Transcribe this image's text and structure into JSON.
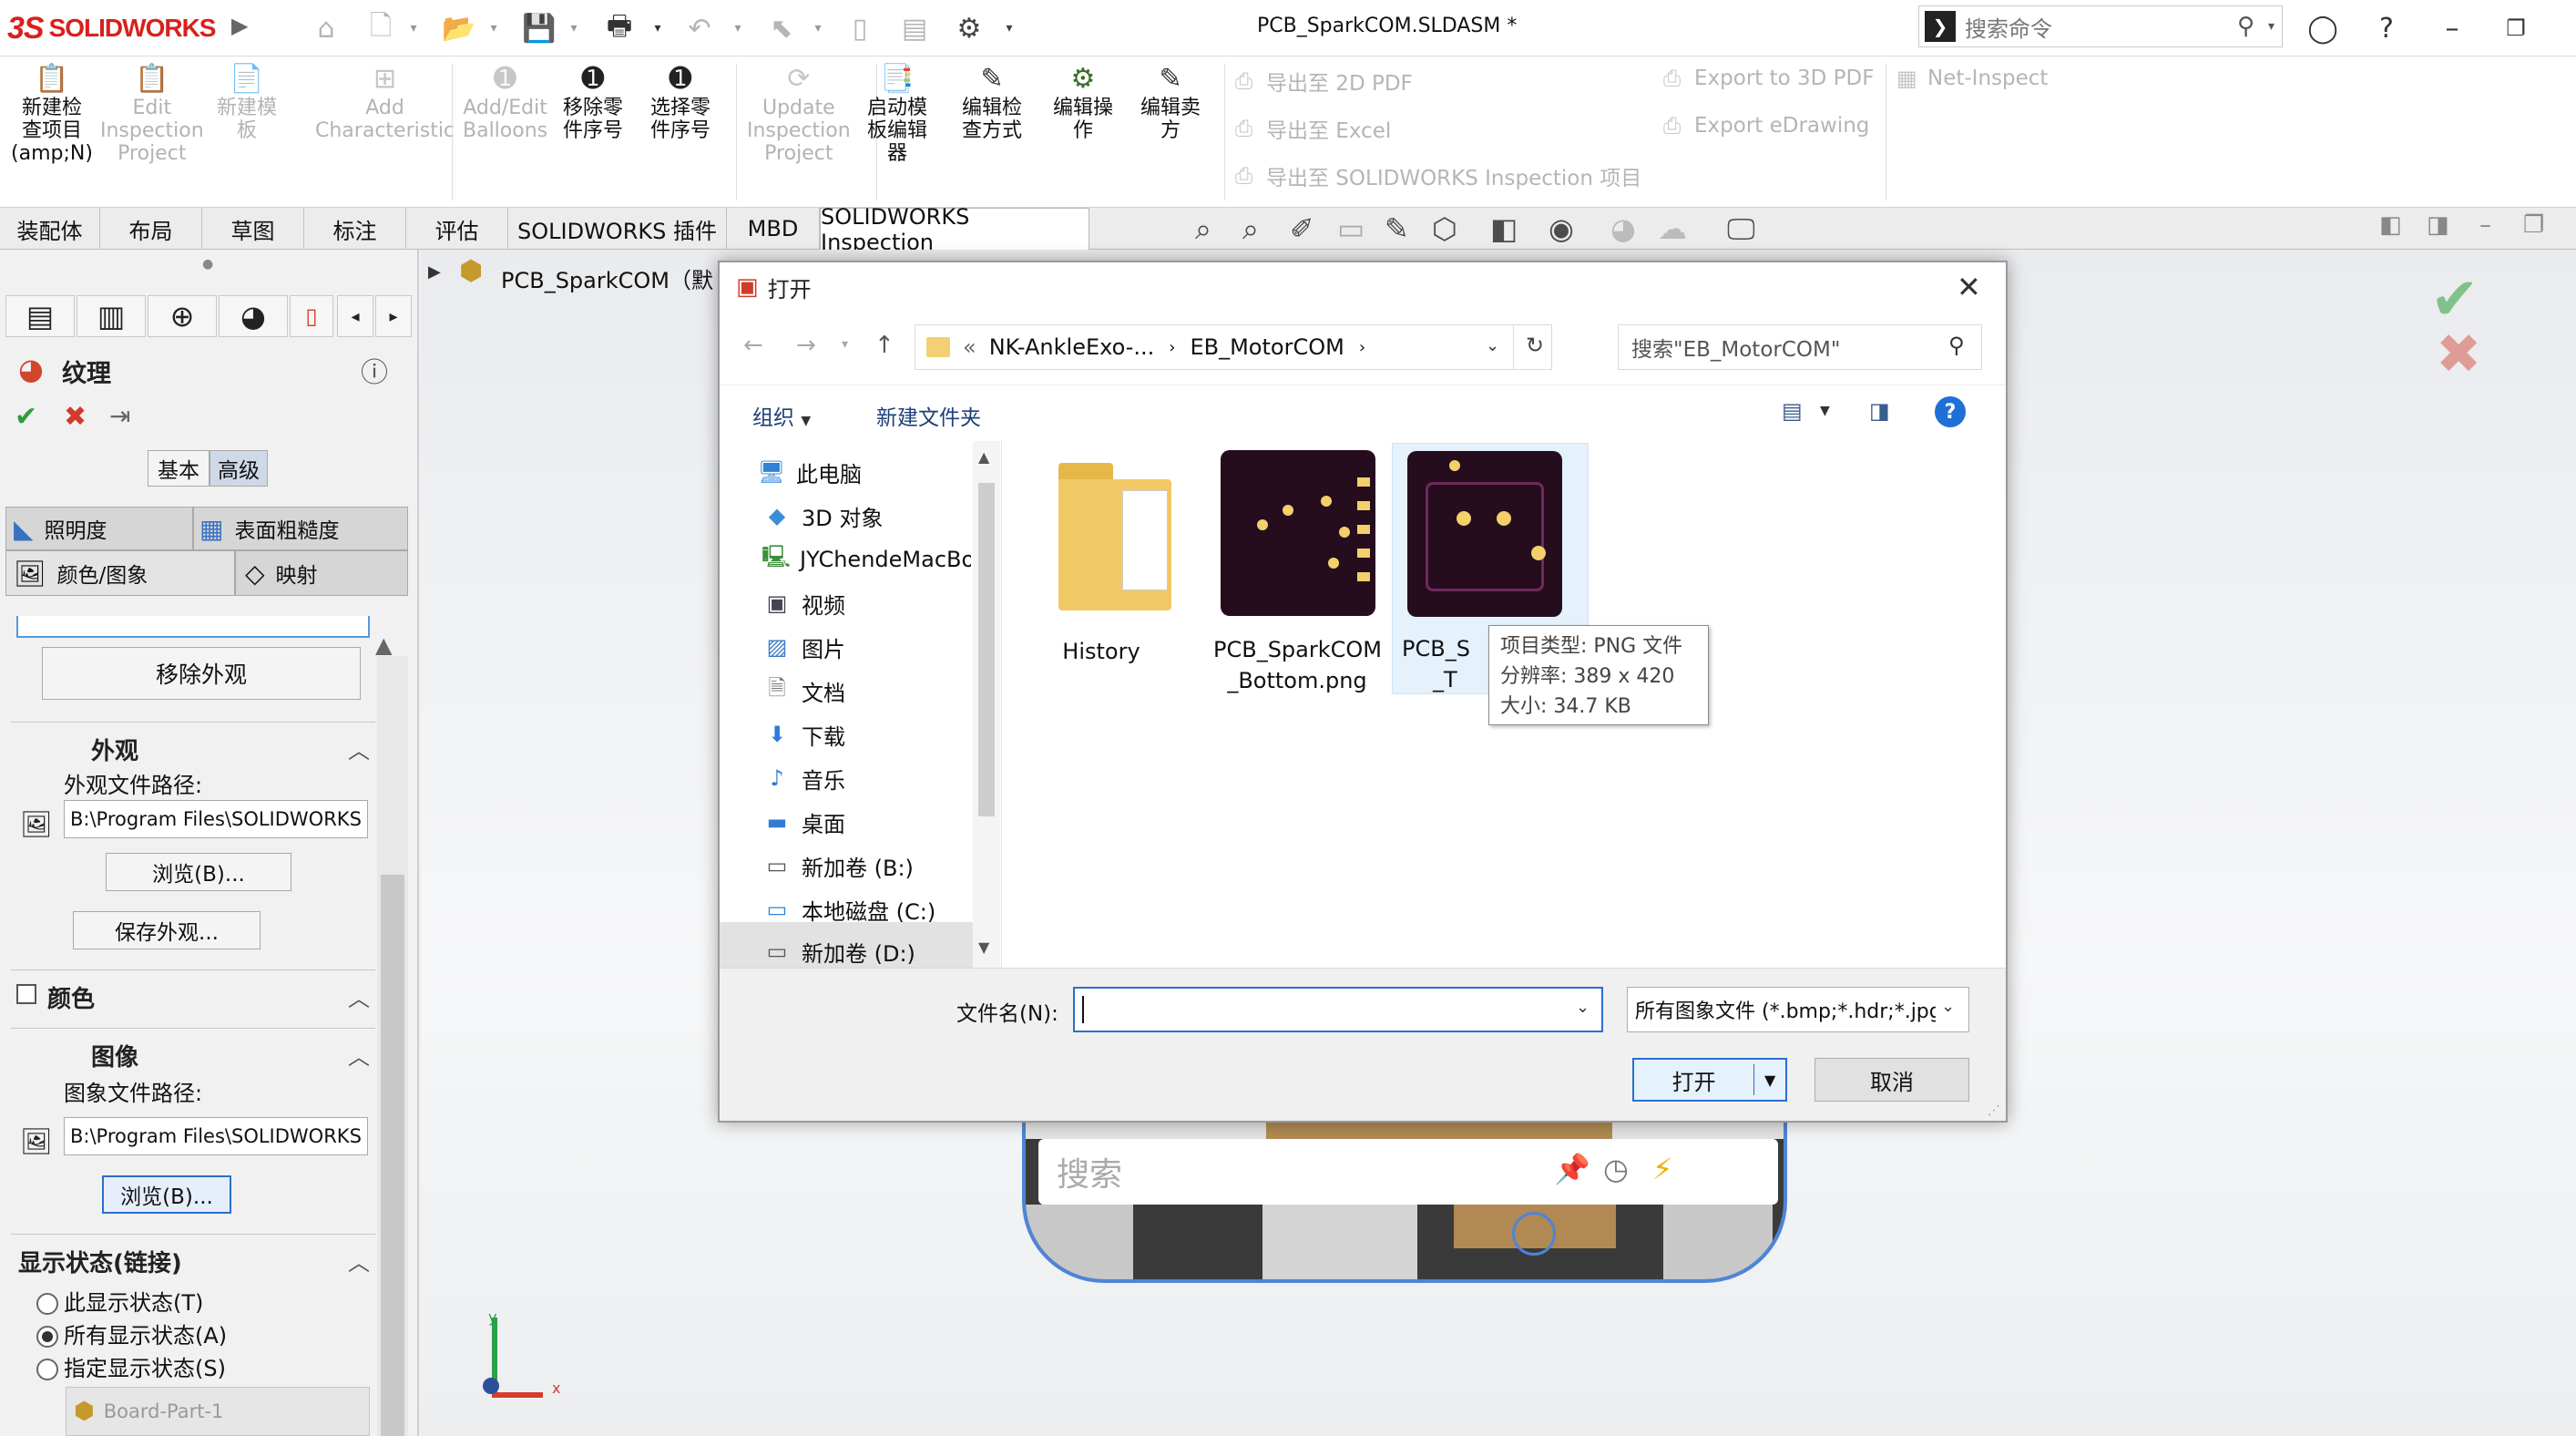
{
  "app": {
    "brand": "SOLIDWORKS",
    "brand_mark": "3S",
    "doc_title": "PCB_SparkCOM.SLDASM *"
  },
  "command_search": {
    "placeholder": "搜索命令"
  },
  "colors": {
    "brand_red": "#d9201c",
    "accent_blue": "#1e6fd6",
    "check_green": "#2e9e3a",
    "x_red": "#d03b2b"
  },
  "ribbon": {
    "buttons": [
      {
        "label": "新建检\n查项目\n(amp;N)",
        "icon": "new-inspection-icon",
        "enabled": true
      },
      {
        "label": "Edit\nInspection\nProject",
        "icon": "edit-inspection-icon",
        "enabled": false
      },
      {
        "label": "新建模\n板",
        "icon": "new-template-icon",
        "enabled": false
      },
      {
        "label": "Add\nCharacteristic",
        "icon": "add-characteristic-icon",
        "enabled": false
      },
      {
        "label": "Add/Edit\nBalloons",
        "icon": "balloons-icon",
        "enabled": false
      },
      {
        "label": "移除零\n件序号",
        "icon": "remove-balloon-icon",
        "enabled": true
      },
      {
        "label": "选择零\n件序号",
        "icon": "select-balloon-icon",
        "enabled": true
      },
      {
        "label": "Update\nInspection\nProject",
        "icon": "update-icon",
        "enabled": false
      },
      {
        "label": "启动模\n板编辑\n器",
        "icon": "template-editor-icon",
        "enabled": true
      },
      {
        "label": "编辑检\n查方式",
        "icon": "edit-method-icon",
        "enabled": true
      },
      {
        "label": "编辑操\n作",
        "icon": "edit-operation-icon",
        "enabled": true
      },
      {
        "label": "编辑卖\n方",
        "icon": "edit-vendor-icon",
        "enabled": true
      }
    ],
    "export_col1": [
      "导出至 2D PDF",
      "导出至 Excel",
      "导出至 SOLIDWORKS Inspection 项目"
    ],
    "export_col2": [
      "Export to 3D PDF",
      "Export eDrawing"
    ],
    "net_inspect": "Net-Inspect"
  },
  "tabs": [
    "装配体",
    "布局",
    "草图",
    "标注",
    "评估",
    "SOLIDWORKS 插件",
    "MBD",
    "SOLIDWORKS Inspection"
  ],
  "tree_root": "PCB_SparkCOM（默",
  "texture_panel": {
    "title": "纹理",
    "mode_basic": "基本",
    "mode_advanced": "高级",
    "subtabs": [
      "照明度",
      "表面粗糙度",
      "颜色/图象",
      "映射"
    ],
    "remove_appearance": "移除外观",
    "appearance": {
      "header": "外观",
      "path_label": "外观文件路径:",
      "path_value": "B:\\Program Files\\SOLIDWORKS Corp\\SOLIDWORKS",
      "browse": "浏览(B)...",
      "save": "保存外观..."
    },
    "color": {
      "header": "颜色"
    },
    "image": {
      "header": "图像",
      "path_label": "图象文件路径:",
      "path_value": "B:\\Program Files\\SOLIDWORKS Corp\\SOLIDWORKS",
      "browse": "浏览(B)..."
    },
    "display_state": {
      "header": "显示状态(链接)",
      "options": [
        "此显示状态(T)",
        "所有显示状态(A)",
        "指定显示状态(S)"
      ],
      "selected": 1
    },
    "component": "Board-Part-1"
  },
  "viewport": {
    "search_placeholder": "搜索",
    "axis_x": "x",
    "axis_y": "y"
  },
  "dialog": {
    "title": "打开",
    "path": [
      "«",
      "NK-AnkleExo-...",
      "EB_MotorCOM"
    ],
    "search_placeholder": "搜索\"EB_MotorCOM\"",
    "organize": "组织",
    "new_folder": "新建文件夹",
    "tree": [
      {
        "label": "此电脑",
        "icon": "computer-icon"
      },
      {
        "label": "3D 对象",
        "icon": "3d-objects-icon"
      },
      {
        "label": "JYChendeMacBook",
        "icon": "network-pc-icon"
      },
      {
        "label": "视频",
        "icon": "video-icon"
      },
      {
        "label": "图片",
        "icon": "pictures-icon"
      },
      {
        "label": "文档",
        "icon": "documents-icon"
      },
      {
        "label": "下载",
        "icon": "download-icon"
      },
      {
        "label": "音乐",
        "icon": "music-icon"
      },
      {
        "label": "桌面",
        "icon": "desktop-icon"
      },
      {
        "label": "新加卷 (B:)",
        "icon": "drive-icon"
      },
      {
        "label": "本地磁盘 (C:)",
        "icon": "system-drive-icon"
      },
      {
        "label": "新加卷 (D:)",
        "icon": "drive-icon"
      }
    ],
    "files": [
      {
        "name": "History",
        "kind": "folder"
      },
      {
        "name": "PCB_SparkCOM\n_Bottom.png",
        "kind": "image"
      },
      {
        "name": "PCB_S",
        "name_tail": "_T",
        "kind": "image"
      }
    ],
    "tooltip": {
      "type": "项目类型: PNG 文件",
      "resolution": "分辨率: 389 x 420",
      "size": "大小: 34.7 KB"
    },
    "filename_label": "文件名(N):",
    "filename_value": "",
    "filter": "所有图象文件 (*.bmp;*.hdr;*.jpg;*.png)",
    "open": "打开",
    "cancel": "取消"
  }
}
